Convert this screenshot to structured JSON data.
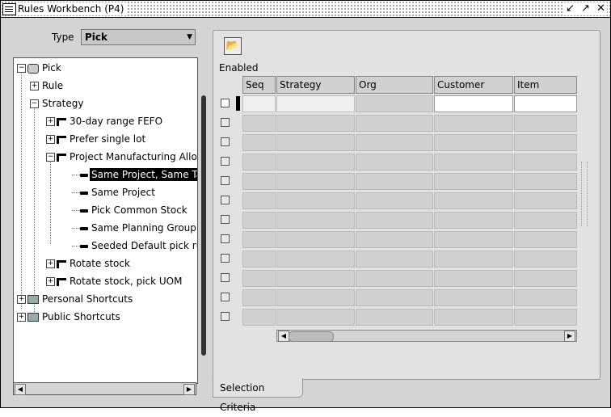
{
  "window": {
    "title": "Rules Workbench (P4)",
    "controls": "↙ ↗ ✕"
  },
  "type_field": {
    "label": "Type",
    "value": "Pick"
  },
  "tree": {
    "nodes": [
      {
        "label": "Pick",
        "icon": "pick-root-icon",
        "expander": "−"
      },
      {
        "label": "Rule",
        "icon": "",
        "expander": "+"
      },
      {
        "label": "Strategy",
        "icon": "",
        "expander": "−"
      },
      {
        "label": "30-day range FEFO",
        "icon": "strategy-icon",
        "expander": "+"
      },
      {
        "label": "Prefer single lot",
        "icon": "strategy-icon",
        "expander": "+"
      },
      {
        "label": "Project Manufacturing Allocation",
        "icon": "strategy-icon",
        "expander": "−"
      },
      {
        "label": "Same Project, Same Task",
        "icon": "rule-icon",
        "expander": ""
      },
      {
        "label": "Same Project",
        "icon": "rule-icon",
        "expander": ""
      },
      {
        "label": "Pick Common Stock",
        "icon": "rule-icon",
        "expander": ""
      },
      {
        "label": "Same Planning Group",
        "icon": "rule-icon",
        "expander": ""
      },
      {
        "label": "Seeded Default pick rule",
        "icon": "rule-icon",
        "expander": ""
      },
      {
        "label": "Rotate stock",
        "icon": "strategy-icon",
        "expander": "+"
      },
      {
        "label": "Rotate stock, pick UOM",
        "icon": "strategy-icon",
        "expander": "+"
      },
      {
        "label": "Personal Shortcuts",
        "icon": "folder-icon",
        "expander": "+"
      },
      {
        "label": "Public Shortcuts",
        "icon": "folder-icon",
        "expander": "+"
      }
    ],
    "selected": "Same Project, Same Task"
  },
  "toolbar": {
    "button_icon": "📂"
  },
  "grid": {
    "enabled_label": "Enabled",
    "columns": [
      "Seq",
      "Strategy",
      "Org",
      "Customer",
      "Item"
    ],
    "row_count": 12
  },
  "tab": {
    "label": "Selection Criteria"
  },
  "scroll_arrows": {
    "left": "◀",
    "right": "▶"
  },
  "select_arrow": "▼"
}
